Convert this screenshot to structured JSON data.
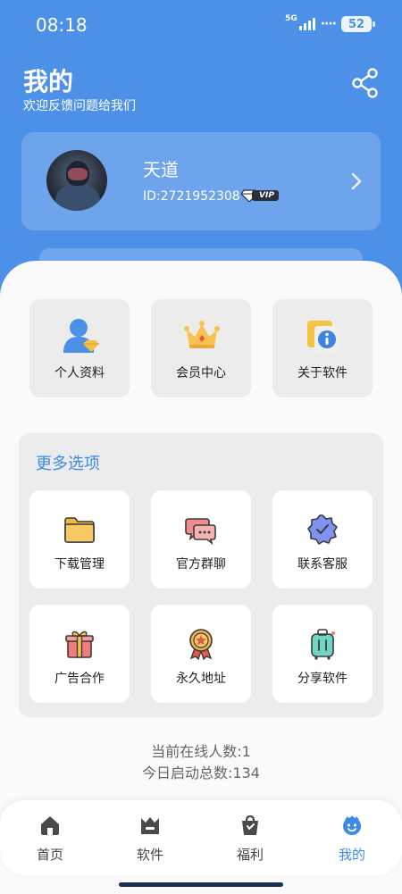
{
  "status_bar": {
    "time": "08:18",
    "network": "5G",
    "battery": "52"
  },
  "header": {
    "title": "我的",
    "subtitle": "欢迎反馈问题给我们",
    "share_icon": "share-icon"
  },
  "profile": {
    "name": "天道",
    "id_text": "ID:2721952308",
    "badge": "VIP"
  },
  "quick_actions": [
    {
      "label": "个人资料",
      "icon": "person-icon"
    },
    {
      "label": "会员中心",
      "icon": "crown-icon"
    },
    {
      "label": "关于软件",
      "icon": "info-icon"
    }
  ],
  "more_options": {
    "title": "更多选项",
    "items": [
      {
        "label": "下载管理",
        "icon": "folder-icon"
      },
      {
        "label": "官方群聊",
        "icon": "chat-icon"
      },
      {
        "label": "联系客服",
        "icon": "verified-badge-icon"
      },
      {
        "label": "广告合作",
        "icon": "gift-icon"
      },
      {
        "label": "永久地址",
        "icon": "medal-icon"
      },
      {
        "label": "分享软件",
        "icon": "luggage-icon"
      }
    ]
  },
  "stats": {
    "online": "当前在线人数:1",
    "launches": "今日启动总数:134"
  },
  "bottom_nav": [
    {
      "label": "首页",
      "icon": "home-icon",
      "active": false
    },
    {
      "label": "软件",
      "icon": "software-icon",
      "active": false
    },
    {
      "label": "福利",
      "icon": "bag-icon",
      "active": false
    },
    {
      "label": "我的",
      "icon": "profile-icon",
      "active": true
    }
  ],
  "colors": {
    "primary": "#4d90e8",
    "accent_text": "#3d8ae6"
  }
}
